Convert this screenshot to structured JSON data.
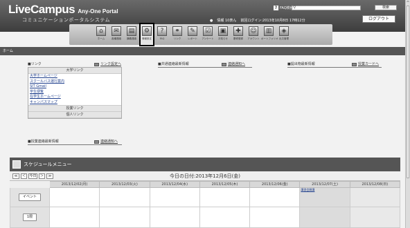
{
  "header": {
    "brand_main": "LiveCampus",
    "brand_sub": "Any-One Portal",
    "tagline": "コミュニケーションポータルシステム",
    "faq_label": "FAQ検索",
    "search_placeholder": "",
    "search_button": "検索",
    "user_name": "情報 10表ん",
    "last_login": "前回ログイン:2013年10月8日 17時12分",
    "logout_button": "ログアウト"
  },
  "nav": {
    "items": [
      {
        "label": "ホーム",
        "icon": "home-icon"
      },
      {
        "label": "各種連絡",
        "icon": "notice-icon"
      },
      {
        "label": "講義連絡",
        "icon": "lecture-icon"
      },
      {
        "label": "情報設定",
        "icon": "settings-icon"
      },
      {
        "label": "FAQ",
        "icon": "faq-icon"
      },
      {
        "label": "リンク",
        "icon": "link-icon"
      },
      {
        "label": "レポート",
        "icon": "report-icon"
      },
      {
        "label": "アンケート",
        "icon": "survey-icon"
      },
      {
        "label": "お知らせ",
        "icon": "info-icon"
      },
      {
        "label": "履修登録",
        "icon": "register-icon"
      },
      {
        "label": "アカウント",
        "icon": "account-icon"
      },
      {
        "label": "ポートフォリオ",
        "icon": "portfolio-icon"
      },
      {
        "label": "出欠管理",
        "icon": "attendance-icon"
      }
    ],
    "active_index": 3
  },
  "breadcrumb": "ホーム",
  "links_panel": {
    "title": "■リンク",
    "settings_link": "リンク設定へ",
    "section_university": "大学リンク",
    "items": [
      "大学ホームページ",
      "スクールバス運行案内",
      "SIT Gmail",
      "学生便覧",
      "在学生ホームページ",
      "キャンパスマップ"
    ],
    "section_class": "授業リンク",
    "section_personal": "個人リンク"
  },
  "common_panel": {
    "title": "■共通連絡最新情報",
    "link": "連絡通知へ"
  },
  "submission_panel": {
    "title": "■提出物最新情報",
    "link": "授業カードへ"
  },
  "class_panel": {
    "title": "■授業連絡最新情報",
    "link": "連絡通知へ"
  },
  "schedule": {
    "title": "スケジュールメニュー",
    "controls": [
      "≪",
      "＜",
      "今日",
      "＞",
      "≫"
    ],
    "today_label": "今日の日付:2013年12月6日(金)",
    "days": [
      "2013/12/02(月)",
      "2013/12/03(火)",
      "2013/12/04(水)",
      "2013/12/05(木)",
      "2013/12/06(金)",
      "2013/12/07(土)",
      "2013/12/08(日)"
    ],
    "row_event": "イベント",
    "row_period": "1限",
    "sat_event": "講習会開講"
  }
}
